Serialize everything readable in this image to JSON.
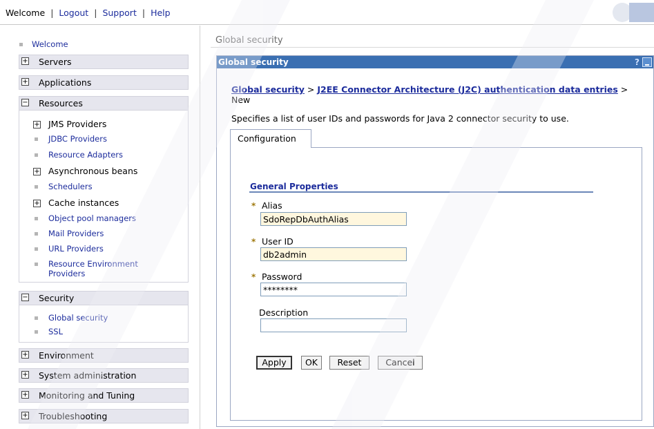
{
  "topbar": {
    "links": [
      "Welcome",
      "Logout",
      "Support",
      "Help"
    ],
    "separator": "|"
  },
  "nav": {
    "welcome": "Welcome",
    "sections": {
      "servers": "Servers",
      "applications": "Applications",
      "resources": "Resources",
      "security": "Security",
      "environment": "Environment",
      "system_administration": "System administration",
      "monitoring": "Monitoring and Tuning",
      "troubleshooting": "Troubleshooting"
    },
    "resources_items": {
      "jms": "JMS Providers",
      "jdbc": "JDBC Providers",
      "adapters": "Resource Adapters",
      "async": "Asynchronous beans",
      "schedulers": "Schedulers",
      "cache": "Cache instances",
      "object_pool": "Object pool managers",
      "mail": "Mail Providers",
      "url": "URL Providers",
      "env_line1": "Resource Environment",
      "env_line2": "Providers"
    },
    "security_items": {
      "global": "Global security",
      "ssl": "SSL"
    }
  },
  "main": {
    "title": "Global security",
    "panel_title": "Global security",
    "help_glyph": "?",
    "breadcrumb": {
      "link1": "Global security",
      "sep": " > ",
      "link2": "J2EE Connector Architecture (J2C) authentication data entries",
      "sep2": " >",
      "current": "New"
    },
    "description": "Specifies a list of user IDs and passwords for Java 2 connector security to use.",
    "tab": "Configuration",
    "general_properties": "General Properties",
    "required_marker": "*",
    "fields": {
      "alias_label": "Alias",
      "alias_value": "SdoRepDbAuthAlias",
      "userid_label": "User ID",
      "userid_value": "db2admin",
      "password_label": "Password",
      "password_value": "********",
      "description_label": "Description",
      "description_value": ""
    },
    "buttons": {
      "apply": "Apply",
      "ok": "OK",
      "reset": "Reset",
      "cancel": "Cancel"
    }
  },
  "colors": {
    "panel_header": "#3a6fb2",
    "link": "#1c2c9c",
    "required_field": "#fff7de"
  }
}
